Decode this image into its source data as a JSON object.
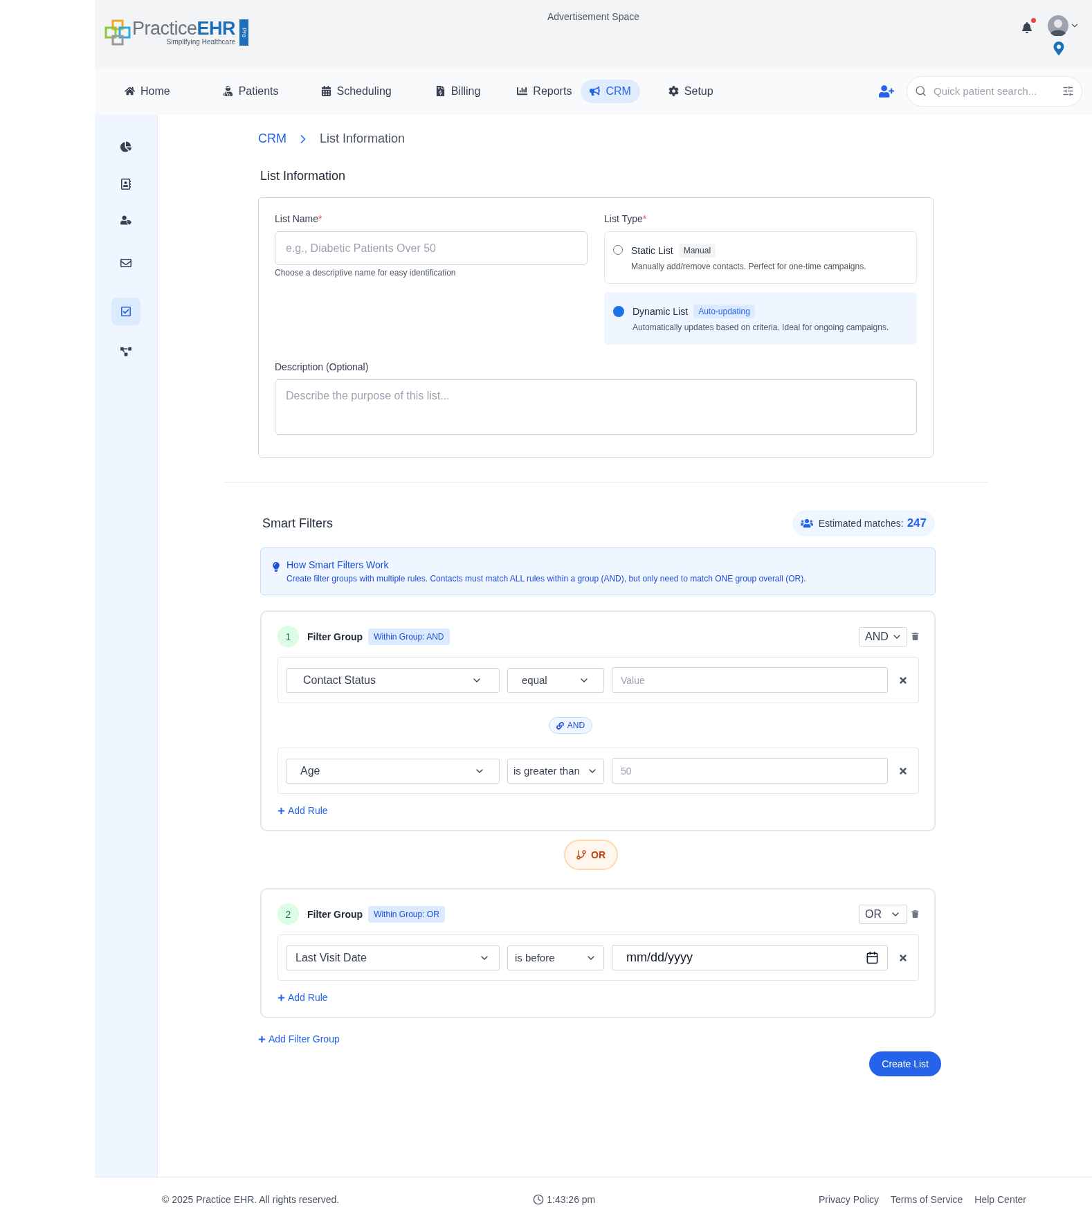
{
  "logo": {
    "name_light": "Practice",
    "name_bold": "EHR",
    "tagline": "Simplifying Healthcare",
    "badge": "Pro"
  },
  "ad_space": "Advertisement Space",
  "notifications": {
    "unread": true
  },
  "nav": [
    {
      "label": "Home",
      "selected": false
    },
    {
      "label": "Patients",
      "selected": false
    },
    {
      "label": "Scheduling",
      "selected": false
    },
    {
      "label": "Billing",
      "selected": false
    },
    {
      "label": "Reports",
      "selected": false
    },
    {
      "label": "CRM",
      "selected": true
    },
    {
      "label": "Setup",
      "selected": false
    }
  ],
  "search": {
    "placeholder": "Quick patient search..."
  },
  "sidebar": {
    "items": [
      {
        "kind": "chart",
        "selected": false
      },
      {
        "kind": "contacts",
        "selected": false
      },
      {
        "kind": "audience",
        "selected": false
      },
      {
        "kind": "email",
        "selected": false
      },
      {
        "kind": "lists",
        "selected": true
      },
      {
        "kind": "workflow",
        "selected": false
      }
    ]
  },
  "breadcrumb": [
    "CRM",
    "List Information"
  ],
  "list_info": {
    "title": "List Information",
    "name_field": {
      "label": "List Name",
      "required_mark": "*",
      "placeholder": "e.g., Diabetic Patients Over 50",
      "hint": "Choose a descriptive name for easy identification"
    },
    "type_field": {
      "label": "List Type",
      "required_mark": "*",
      "options": [
        {
          "label": "Static List",
          "badge": "Manual",
          "description": "Manually add/remove contacts. Perfect for one-time campaigns.",
          "selected": false
        },
        {
          "label": "Dynamic List",
          "badge": "Auto-updating",
          "description": "Automatically updates based on criteria. Ideal for ongoing campaigns.",
          "selected": true
        }
      ]
    },
    "description_field": {
      "label": "Description (Optional)",
      "placeholder": "Describe the purpose of this list..."
    }
  },
  "smart_filters": {
    "title": "Smart Filters",
    "matches_label": "Estimated matches:",
    "matches_value": "247",
    "info": {
      "title": "How Smart Filters Work",
      "text": "Create filter groups with multiple rules. Contacts must match ALL rules within a group (AND), but only need to match ONE group overall (OR)."
    },
    "groups": [
      {
        "number": "1",
        "title": "Filter Group",
        "badge": "Within Group: AND",
        "logic": "AND",
        "rule_connector": "AND",
        "add_rule": "Add Rule",
        "rules": [
          {
            "field": "Contact Status",
            "operator": "equal",
            "kind": "text",
            "placeholder": "Value"
          },
          {
            "field": "Age",
            "operator": "is greater than",
            "kind": "text",
            "placeholder": "50"
          }
        ]
      },
      {
        "number": "2",
        "title": "Filter Group",
        "badge": "Within Group: OR",
        "logic": "OR",
        "add_rule": "Add Rule",
        "rules": [
          {
            "field": "Last Visit Date",
            "operator": "is before",
            "kind": "date",
            "value": "mm/dd/yyyy"
          }
        ]
      }
    ],
    "group_connector": "OR",
    "add_group": "Add Filter Group",
    "submit": "Create List"
  },
  "footer": {
    "copyright": "© 2025 Practice EHR. All rights reserved.",
    "time": "1:43:26 pm",
    "links": [
      "Privacy Policy",
      "Terms of Service",
      "Help Center"
    ]
  }
}
